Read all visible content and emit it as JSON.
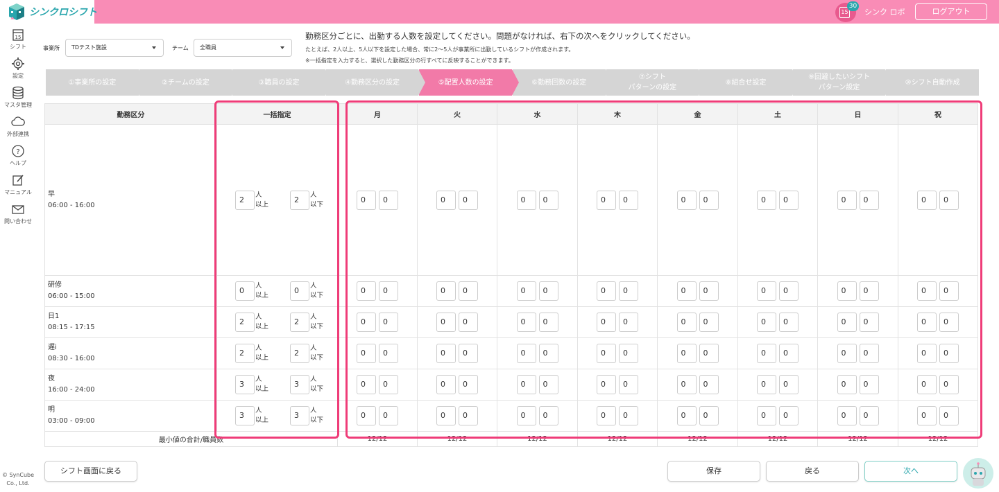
{
  "app": {
    "logo_text": "シンクロシフト",
    "notif_count": "30",
    "notif_day": "15",
    "user_name": "シンク ロボ",
    "logout_label": "ログアウト"
  },
  "sidebar": [
    {
      "icon": "calendar-icon",
      "label": "シフト",
      "glyph": "15"
    },
    {
      "icon": "gear-icon",
      "label": "設定"
    },
    {
      "icon": "database-icon",
      "label": "マスタ管理"
    },
    {
      "icon": "cloud-icon",
      "label": "外部連携"
    },
    {
      "icon": "help-icon",
      "label": "ヘルプ"
    },
    {
      "icon": "edit-icon",
      "label": "マニュアル"
    },
    {
      "icon": "mail-icon",
      "label": "問い合わせ"
    }
  ],
  "copyright": "© SynCube Co., Ltd.",
  "filters": {
    "office_label": "事業所",
    "office_value": "TDテスト施設",
    "team_label": "チーム",
    "team_value": "全職員"
  },
  "instructions": {
    "line1": "勤務区分ごとに、出勤する人数を設定してください。問題がなければ、右下の次へをクリックしてください。",
    "line2": "たとえば、2人以上、5人以下を設定した場合、常に2〜5人が事業所に出勤しているシフトが作成されます。",
    "line3": "※一括指定を入力すると、選択した勤務区分の行すべてに反映することができます。"
  },
  "steps": [
    "①事業所の設定",
    "②チームの設定",
    "③職員の設定",
    "④勤務区分の設定",
    "⑤配置人数の設定",
    "⑥勤務回数の設定",
    "⑦シフト\nパターンの設定",
    "⑧組合せ設定",
    "⑨回避したいシフト\nパターン設定",
    "⑩シフト自動作成"
  ],
  "active_step": 4,
  "table": {
    "col_header": "勤務区分",
    "bulk_header": "一括指定",
    "unit_min": "人\n以上",
    "unit_max": "人\n以下",
    "days": [
      "月",
      "火",
      "水",
      "木",
      "金",
      "土",
      "日",
      "祝"
    ],
    "rows": [
      {
        "name": "早",
        "time": "06:00 - 16:00",
        "min": "2",
        "max": "2",
        "cells": [
          "0",
          "0"
        ]
      },
      {
        "name": "研修",
        "time": "06:00 - 15:00",
        "min": "0",
        "max": "0",
        "cells": [
          "0",
          "0"
        ]
      },
      {
        "name": "日1",
        "time": "08:15 - 17:15",
        "min": "2",
        "max": "2",
        "cells": [
          "0",
          "0"
        ]
      },
      {
        "name": "遅i",
        "time": "08:30 - 16:00",
        "min": "2",
        "max": "2",
        "cells": [
          "0",
          "0"
        ]
      },
      {
        "name": "夜",
        "time": "16:00 - 24:00",
        "min": "3",
        "max": "3",
        "cells": [
          "0",
          "0"
        ]
      },
      {
        "name": "明",
        "time": "03:00 - 09:00",
        "min": "3",
        "max": "3",
        "cells": [
          "0",
          "0"
        ]
      }
    ],
    "footer_label": "最小値の合計/職員数",
    "footer_values": [
      "12/12",
      "12/12",
      "12/12",
      "12/12",
      "12/12",
      "12/12",
      "12/12",
      "12/12"
    ]
  },
  "buttons": {
    "back_to_shift": "シフト画面に戻る",
    "save": "保存",
    "back": "戻る",
    "next": "次へ"
  },
  "colors": {
    "brand_pink": "#f98cb6",
    "active_step": "#f27aa8",
    "accent_teal": "#2aa6ad",
    "highlight": "#ef3c78"
  }
}
